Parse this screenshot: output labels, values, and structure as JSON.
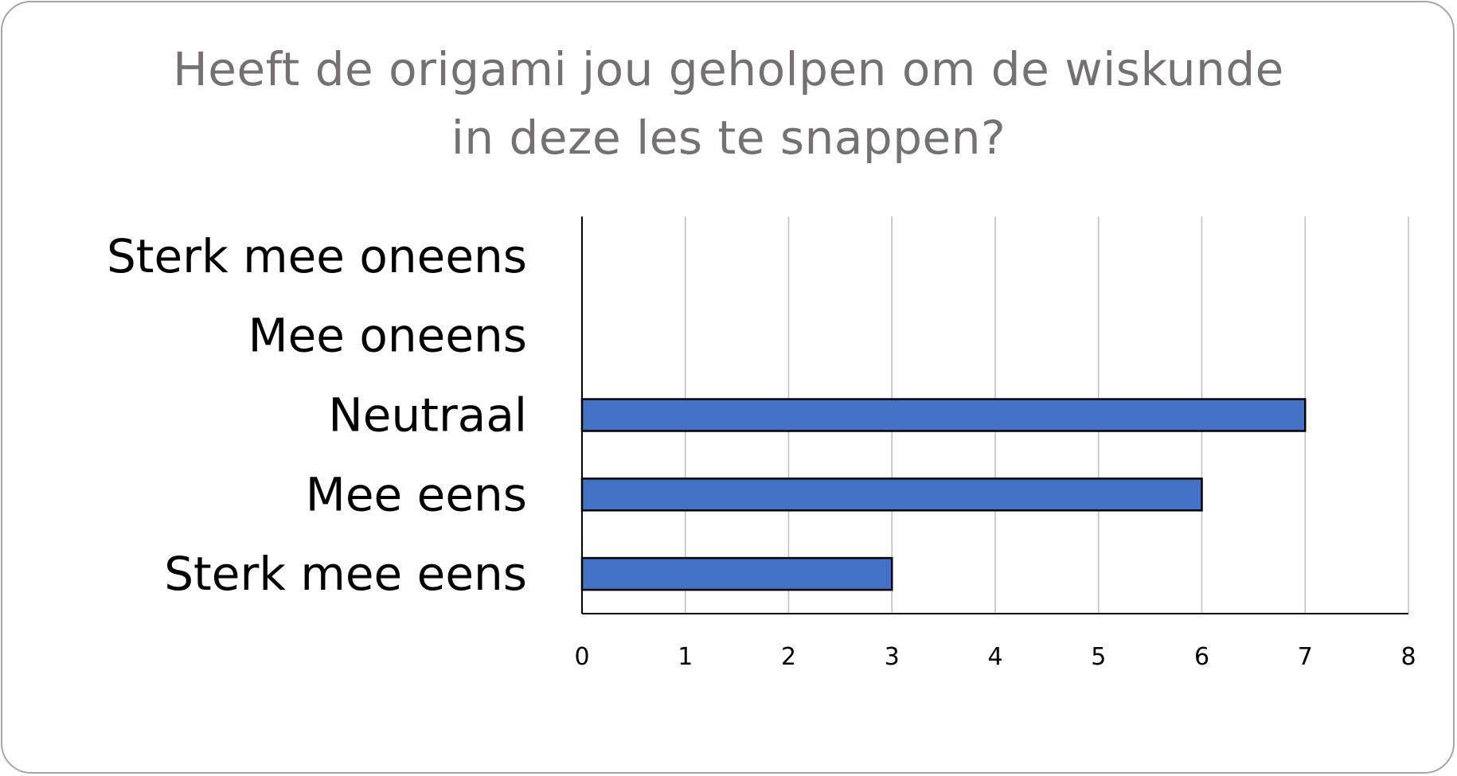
{
  "chart_data": {
    "type": "bar",
    "orientation": "horizontal",
    "title_lines": [
      "Heeft de origami jou geholpen om de wiskunde",
      "in deze les te snappen?"
    ],
    "categories": [
      "Sterk mee oneens",
      "Mee oneens",
      "Neutraal",
      "Mee eens",
      "Sterk mee eens"
    ],
    "values": [
      0,
      0,
      7,
      6,
      3
    ],
    "xlim": [
      0,
      8
    ],
    "xticks": [
      0,
      1,
      2,
      3,
      4,
      5,
      6,
      7,
      8
    ],
    "grid": "vertical",
    "legend": "none",
    "colors": {
      "bar_fill": "#4472c4",
      "bar_stroke": "#000000",
      "grid": "#bfbfbf",
      "title": "#767171",
      "frame": "#a6a6a6"
    }
  }
}
